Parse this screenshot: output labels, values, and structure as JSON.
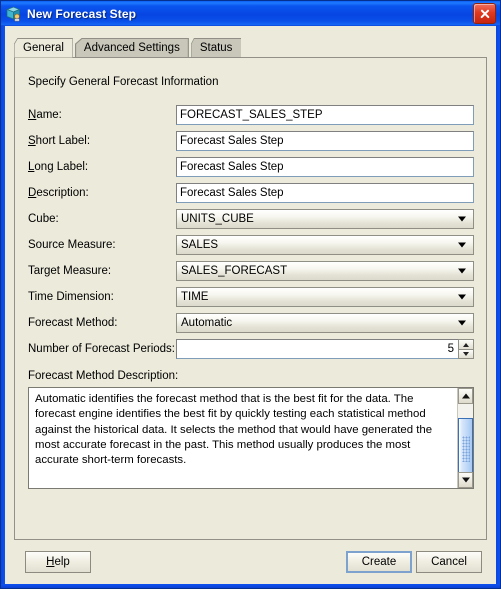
{
  "window": {
    "title": "New Forecast Step",
    "icon": "cube-forecast-icon",
    "close_label": "Close",
    "accent_titlebar": "#0a4fe8",
    "background": "#eceadb"
  },
  "tabs": [
    {
      "label": "General",
      "active": true
    },
    {
      "label": "Advanced Settings",
      "active": false
    },
    {
      "label": "Status",
      "active": false
    }
  ],
  "panel": {
    "section_title": "Specify General Forecast Information"
  },
  "fields": [
    {
      "label": "Name:",
      "mnemonic": "N",
      "type": "text",
      "value": "FORECAST_SALES_STEP"
    },
    {
      "label": "Short Label:",
      "mnemonic": "S",
      "type": "text",
      "value": "Forecast Sales Step"
    },
    {
      "label": "Long Label:",
      "mnemonic": "L",
      "type": "text",
      "value": "Forecast Sales Step"
    },
    {
      "label": "Description:",
      "mnemonic": "D",
      "type": "text",
      "value": "Forecast Sales Step"
    },
    {
      "label": "Cube:",
      "mnemonic": "",
      "type": "combo",
      "value": "UNITS_CUBE"
    },
    {
      "label": "Source Measure:",
      "mnemonic": "",
      "type": "combo",
      "value": "SALES"
    },
    {
      "label": "Target Measure:",
      "mnemonic": "",
      "type": "combo",
      "value": "SALES_FORECAST"
    },
    {
      "label": "Time Dimension:",
      "mnemonic": "",
      "type": "combo",
      "value": "TIME"
    },
    {
      "label": "Forecast Method:",
      "mnemonic": "",
      "type": "combo",
      "value": "Automatic"
    },
    {
      "label": "Number of Forecast Periods:",
      "mnemonic": "",
      "type": "spinner",
      "value": "5"
    }
  ],
  "description": {
    "label": "Forecast Method Description:",
    "text": "Automatic identifies the forecast method that is the best fit for the data. The forecast engine identifies the best fit by quickly testing each statistical method against the historical data. It selects the method that would have generated the most accurate forecast in the past. This method usually produces the most accurate short-term forecasts."
  },
  "buttons": {
    "help": "Help",
    "help_mnemonic": "H",
    "create": "Create",
    "cancel": "Cancel"
  }
}
